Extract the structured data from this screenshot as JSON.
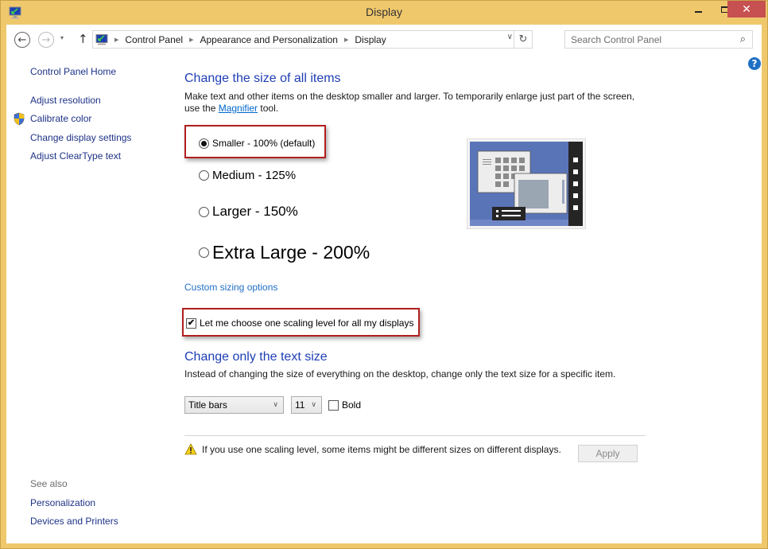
{
  "window": {
    "title": "Display",
    "controls": {
      "minimize": "minimize",
      "maximize": "maximize",
      "close": "✕"
    }
  },
  "nav": {
    "back_icon": "←",
    "forward_icon": "→",
    "recent_icon": "▾",
    "up_icon": "↑",
    "breadcrumb": [
      "Control Panel",
      "Appearance and Personalization",
      "Display"
    ],
    "breadcrumb_sep": "▶",
    "dropdown_icon": "∨",
    "refresh_icon": "↻",
    "search_placeholder": "Search Control Panel",
    "search_icon": "⌕",
    "help_icon": "?"
  },
  "sidebar": {
    "home": "Control Panel Home",
    "links": [
      "Adjust resolution",
      "Calibrate color",
      "Change display settings",
      "Adjust ClearType text"
    ],
    "see_also_label": "See also",
    "see_also": [
      "Personalization",
      "Devices and Printers"
    ]
  },
  "main": {
    "size_heading": "Change the size of all items",
    "size_desc_before": "Make text and other items on the desktop smaller and larger. To temporarily enlarge just part of the screen, use the ",
    "size_desc_link": "Magnifier",
    "size_desc_after": " tool.",
    "options": [
      {
        "label": "Smaller - 100% (default)",
        "checked": true
      },
      {
        "label": "Medium - 125%",
        "checked": false
      },
      {
        "label": "Larger - 150%",
        "checked": false
      },
      {
        "label": "Extra Large - 200%",
        "checked": false
      }
    ],
    "custom_sizing": "Custom sizing options",
    "one_scaling_label": "Let me choose one scaling level for all my displays",
    "one_scaling_checked": true,
    "check_glyph": "✔",
    "text_heading": "Change only the text size",
    "text_desc": "Instead of changing the size of everything on the desktop, change only the text size for a specific item.",
    "item_select": "Title bars",
    "size_select": "11",
    "select_chevron": "∨",
    "bold_label": "Bold",
    "bold_checked": false,
    "warning": "If you use one scaling level, some items might be different sizes on different displays.",
    "apply": "Apply"
  },
  "colors": {
    "frame": "#efc86c",
    "close": "#c75050",
    "heading": "#1e3eb4",
    "link": "#1e3287",
    "highlight": "#b11f1f"
  }
}
